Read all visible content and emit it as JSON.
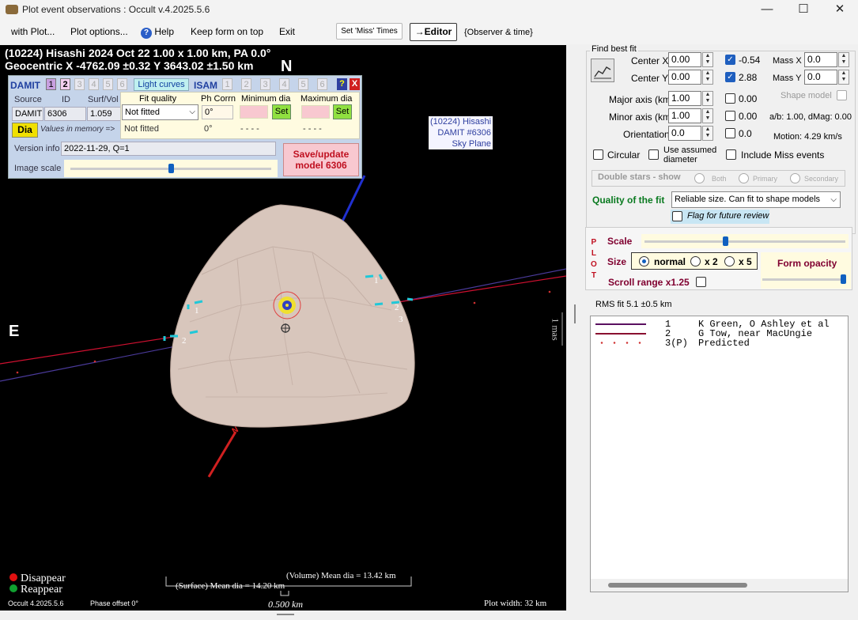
{
  "window": {
    "title": "Plot event observations : Occult v.4.2025.5.6",
    "minimize": "—",
    "maximize": "☐",
    "close": "✕"
  },
  "menu": {
    "with_plot": "with Plot...",
    "plot_options": "Plot options...",
    "help": "Help",
    "keep_on_top": "Keep form on top",
    "exit": "Exit",
    "set_miss": "Set 'Miss' Times",
    "editor": "→Editor",
    "observer_time": "{Observer & time}"
  },
  "plot": {
    "header1": "(10224) Hisashi  2024 Oct 22   1.00 x 1.00 km, PA 0.0°",
    "header2": "Geocentric  X  -4762.09 ±0.32  Y 3643.02 ±1.50 km",
    "north": "N",
    "east": "E",
    "skyplane": [
      "(10224) Hisashi",
      "DAMIT #6306",
      "Sky Plane"
    ],
    "pole_label": "N",
    "chord_labels": [
      "1",
      "2",
      "1",
      "2",
      "3"
    ],
    "mas": "1 mas",
    "legend_disappear": "Disappear",
    "legend_reappear": "Reappear",
    "volume_dia": "(Volume) Mean dia = 13.42 km",
    "surface_dia": "(Surface) Mean dia = 14.20 km",
    "scale_km": "0.500 km",
    "version": "Occult 4.2025.5.6",
    "phase_offset": "Phase offset 0°",
    "plot_width": "Plot width: 32 km",
    "colors": {
      "disappear": "#e01010",
      "reappear": "#10a030",
      "chord1": "#4a3a9a",
      "chord2": "#d01030",
      "body": "#d8c6bc"
    }
  },
  "damit": {
    "damit_label": "DAMIT",
    "tabs": [
      "1",
      "2",
      "3",
      "4",
      "5",
      "6"
    ],
    "light_curves": "Light curves",
    "isam_label": "ISAM",
    "isam_tabs": [
      "1",
      "2",
      "3",
      "4",
      "5",
      "6"
    ],
    "help_btn": "?",
    "close_btn": "X",
    "col_source": "Source",
    "col_id": "ID",
    "col_surfvol": "Surf/Vol",
    "source_val": "DAMIT",
    "id_val": "6306",
    "surfvol_val": "1.059",
    "dia_btn": "Dia",
    "values_in_memory": "Values in memory =>",
    "fit_quality_label": "Fit quality",
    "fit_quality_sel": "Not fitted",
    "fit_quality_mem": "Not fitted",
    "ph_corrn_label": "Ph Corrn",
    "ph_corrn_val": "0°",
    "ph_corrn_mem": "0°",
    "min_dia_label": "Minimum dia",
    "max_dia_label": "Maximum dia",
    "set_btn": "Set",
    "dashes": "- - - -",
    "version_info_label": "Version info",
    "version_info_val": "2022-11-29, Q=1",
    "image_scale_label": "Image scale",
    "save_update": "Save/update",
    "model_label": "model 6306"
  },
  "fit": {
    "group_label": "Find best fit",
    "center_x_label": "Center X",
    "center_x_val": "0.00",
    "center_y_label": "Center Y",
    "center_y_val": "0.00",
    "center_x_result": "-0.54",
    "center_y_result": "2.88",
    "mass_x_label": "Mass X",
    "mass_x_val": "0.0",
    "mass_y_label": "Mass Y",
    "mass_y_val": "0.0",
    "major_label": "Major axis (km)",
    "major_val": "1.00",
    "major_result": "0.00",
    "shape_model_label": "Shape model",
    "minor_label": "Minor axis (km)",
    "minor_val": "1.00",
    "minor_result": "0.00",
    "ab_dmag": "a/b: 1.00, dMag: 0.00",
    "orientation_label": "Orientation",
    "orientation_val": "0.0",
    "orientation_result": "0.0",
    "motion": "Motion: 4.29 km/s",
    "circular_label": "Circular",
    "use_assumed_1": "Use assumed",
    "use_assumed_2": "diameter",
    "include_miss": "Include Miss events",
    "double_stars": "Double stars - show",
    "both": "Both",
    "primary": "Primary",
    "secondary": "Secondary",
    "quality_label": "Quality of the fit",
    "quality_val": "Reliable size. Can fit to shape models",
    "flag_review": "Flag for future review",
    "plot_letters": [
      "P",
      "L",
      "O",
      "T"
    ],
    "scale_label": "Scale",
    "size_label": "Size",
    "size_normal": "normal",
    "size_x2": "x 2",
    "size_x5": "x 5",
    "form_opacity": "Form opacity",
    "scroll_range": "Scroll range x1.25",
    "rms_fit": "RMS fit 5.1 ±0.5 km"
  },
  "observers": [
    {
      "num": "1",
      "name": "K Green, O Ashley et al",
      "color": "#5a1060"
    },
    {
      "num": "2",
      "name": "G Tow, near MacUngie",
      "color": "#8a1030"
    },
    {
      "num": "3(P)",
      "name": "Predicted",
      "color": "#d03030"
    }
  ]
}
